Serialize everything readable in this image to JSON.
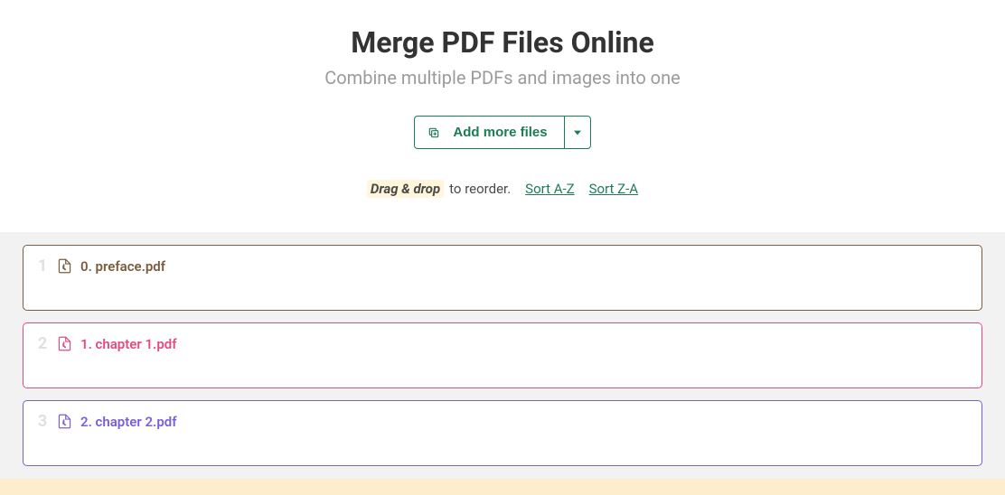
{
  "header": {
    "title": "Merge PDF Files Online",
    "subtitle": "Combine multiple PDFs and images into one"
  },
  "toolbar": {
    "add_more_label": "Add more files"
  },
  "reorder": {
    "drag_drop_label": "Drag & drop",
    "to_reorder_label": " to reorder.",
    "sort_az_label": "Sort A-Z",
    "sort_za_label": "Sort Z-A"
  },
  "files": [
    {
      "index": "1",
      "name": "0. preface.pdf",
      "color": "#7a5c3e"
    },
    {
      "index": "2",
      "name": "1. chapter 1.pdf",
      "color": "#e34d7c"
    },
    {
      "index": "3",
      "name": "2. chapter 2.pdf",
      "color": "#7b5fd9"
    }
  ]
}
